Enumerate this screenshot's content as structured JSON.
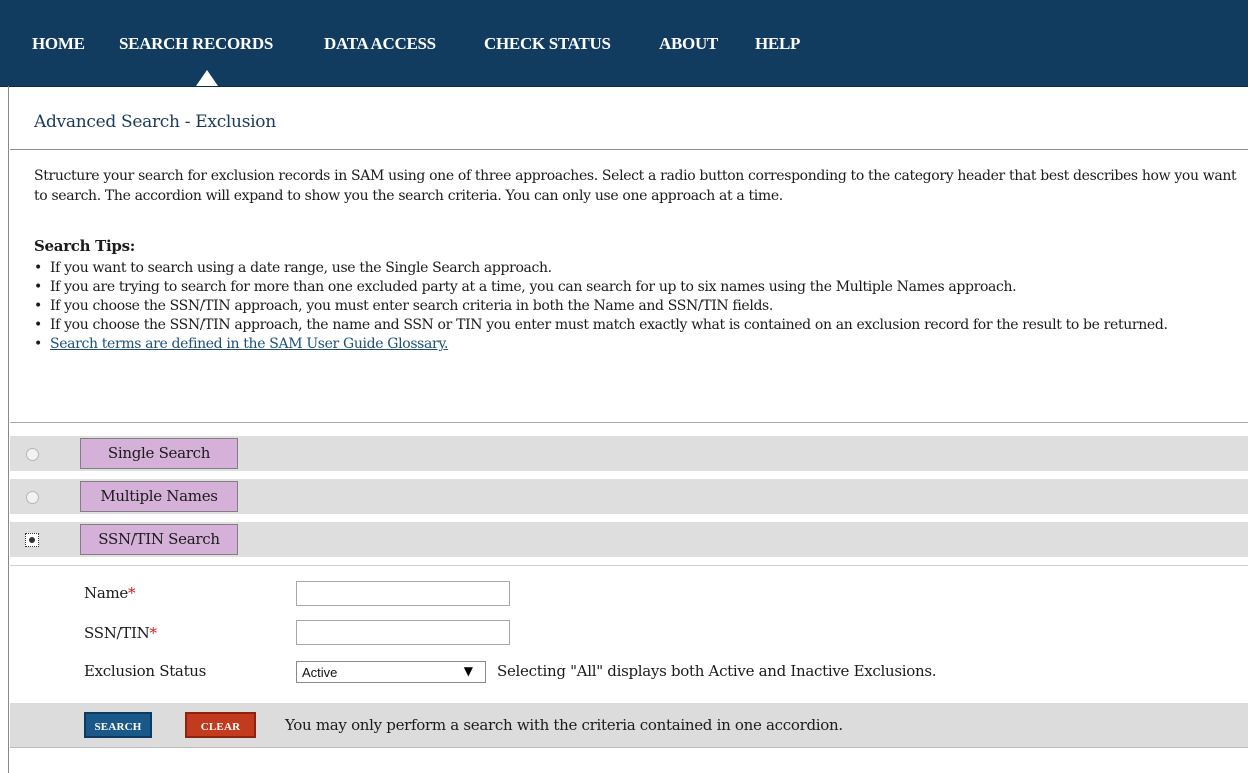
{
  "nav": {
    "items": [
      {
        "label": "HOME"
      },
      {
        "label": "SEARCH RECORDS"
      },
      {
        "label": "DATA ACCESS"
      },
      {
        "label": "CHECK STATUS"
      },
      {
        "label": "ABOUT"
      },
      {
        "label": "HELP"
      }
    ],
    "active_item": "SEARCH RECORDS",
    "background_color": "#123b60"
  },
  "page": {
    "title": "Advanced Search - Exclusion",
    "intro": "Structure your search for exclusion records in SAM using one of three approaches. Select a radio button corresponding to the category header that best describes how you want to search. The accordion will expand to show you the search criteria. You can only use one approach at a time."
  },
  "tips": {
    "heading": "Search Tips:",
    "items": [
      "If you want to search using a date range, use the Single Search approach.",
      "If you are trying to search for more than one excluded party at a time, you can search for up to six names using the Multiple Names approach.",
      "If you choose the SSN/TIN approach, you must enter search criteria in both the Name and SSN/TIN fields.",
      "If you choose the SSN/TIN approach, the name and SSN or TIN you enter must match exactly what is contained on an exclusion record for the result to be returned."
    ],
    "link": "Search terms are defined in the SAM User Guide Glossary."
  },
  "accordion": {
    "sections": [
      {
        "label": "Single Search",
        "selected": false
      },
      {
        "label": "Multiple Names",
        "selected": false
      },
      {
        "label": "SSN/TIN Search",
        "selected": true
      }
    ],
    "header_color": "#d5b1d9"
  },
  "form": {
    "name_label": "Name",
    "name_value": "",
    "ssn_label": "SSN/TIN",
    "ssn_value": "",
    "required_marker": "*",
    "status_label": "Exclusion Status",
    "status_selected": "Active",
    "status_note": "Selecting \"All\" displays both Active and Inactive Exclusions."
  },
  "actions": {
    "search_label": "SEARCH",
    "clear_label": "CLEAR",
    "note": "You may only perform a search with the criteria contained in one accordion.",
    "search_color": "#1a5889",
    "clear_color": "#c23b1e"
  }
}
